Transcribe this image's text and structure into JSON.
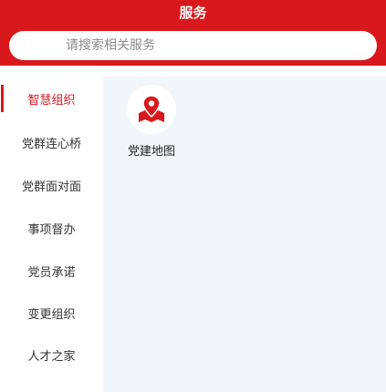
{
  "header": {
    "title": "服务",
    "background_color": "#d8181c"
  },
  "search": {
    "placeholder": "请搜索相关服务"
  },
  "sidebar": {
    "active_color": "#d8181c",
    "items": [
      {
        "label": "智慧组织",
        "active": true
      },
      {
        "label": "党群连心桥",
        "active": false
      },
      {
        "label": "党群面对面",
        "active": false
      },
      {
        "label": "事项督办",
        "active": false
      },
      {
        "label": "党员承诺",
        "active": false
      },
      {
        "label": "变更组织",
        "active": false
      },
      {
        "label": "人才之家",
        "active": false
      }
    ]
  },
  "content": {
    "services": [
      {
        "label": "党建地图",
        "icon": "map-pin-icon"
      }
    ]
  }
}
